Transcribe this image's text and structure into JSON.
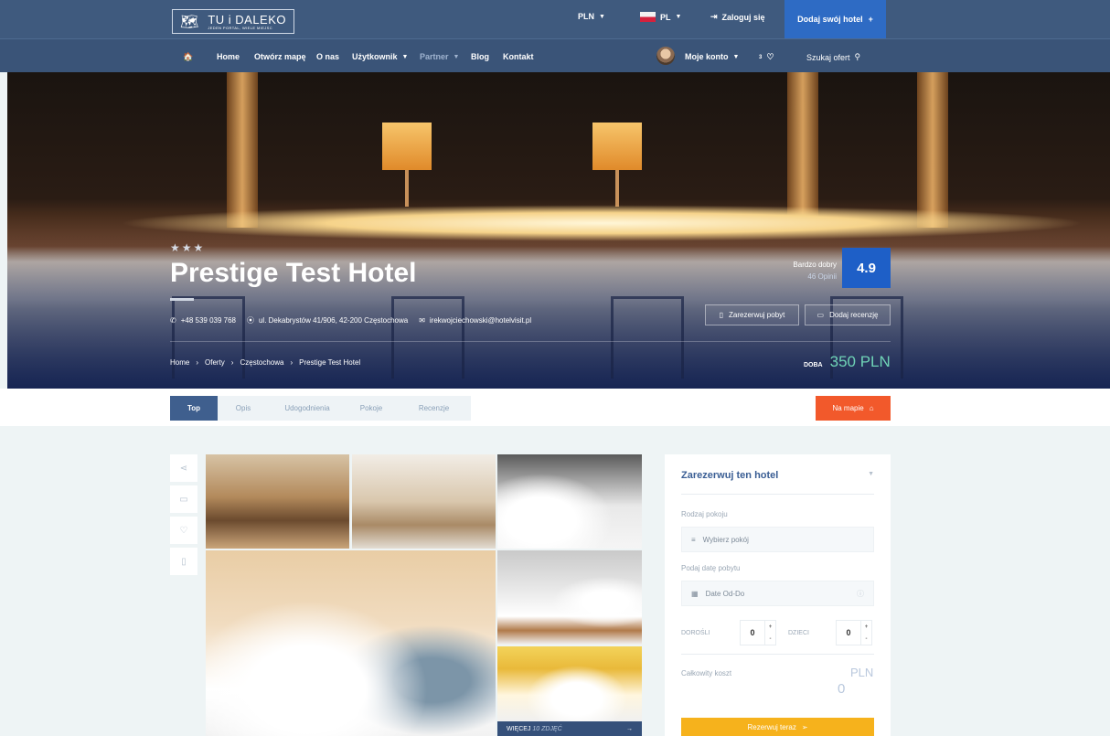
{
  "header": {
    "logo": {
      "title": "TU i DALEKO",
      "subtitle": "JEDEN PORTAL, WIELE MIEJSC"
    },
    "currency": "PLN",
    "language": "PL",
    "login": "Zaloguj się",
    "add_hotel": "Dodaj swój hotel"
  },
  "nav": {
    "items": [
      "Home",
      "Otwórz mapę",
      "O nas",
      "Użytkownik",
      "Partner",
      "Blog",
      "Kontakt"
    ],
    "account": "Moje konto",
    "favorites_count": "3",
    "search": "Szukaj ofert"
  },
  "hotel": {
    "stars": 3,
    "name": "Prestige Test Hotel",
    "rating_label": "Bardzo dobry",
    "reviews": "46 Opinii",
    "score": "4.9",
    "phone": "+48 539 039 768",
    "address": "ul. Dekabrystów 41/906, 42-200 Częstochowa",
    "email": "irekwojciechowski@hotelvisit.pl",
    "book_button": "Zarezerwuj pobyt",
    "review_button": "Dodaj recenzję",
    "breadcrumb": [
      "Home",
      "Oferty",
      "Częstochowa",
      "Prestige Test Hotel"
    ],
    "price_label": "DOBA",
    "price": "350 PLN"
  },
  "tabs": [
    "Top",
    "Opis",
    "Udogodnienia",
    "Pokoje",
    "Recenzje"
  ],
  "map_button": "Na mapie",
  "gallery": {
    "more_label": "WIĘCEJ",
    "count": "10 ZDJĘĆ"
  },
  "booking": {
    "title": "Zarezerwuj ten hotel",
    "room_label": "Rodzaj pokoju",
    "room_placeholder": "Wybierz pokój",
    "date_label": "Podaj datę pobytu",
    "date_placeholder": "Date Od-Do",
    "adults_label": "DOROŚLI",
    "adults": "0",
    "children_label": "DZIECI",
    "children": "0",
    "total_label": "Całkowity koszt",
    "currency": "PLN",
    "total": "0",
    "reserve_button": "Rezerwuj teraz"
  },
  "colors": {
    "topbar": "#3f5a7e",
    "accent_blue": "#1e5fc7",
    "accent_orange": "#f2592b",
    "accent_yellow": "#f6b21c",
    "price_green": "#6fd3b6"
  }
}
